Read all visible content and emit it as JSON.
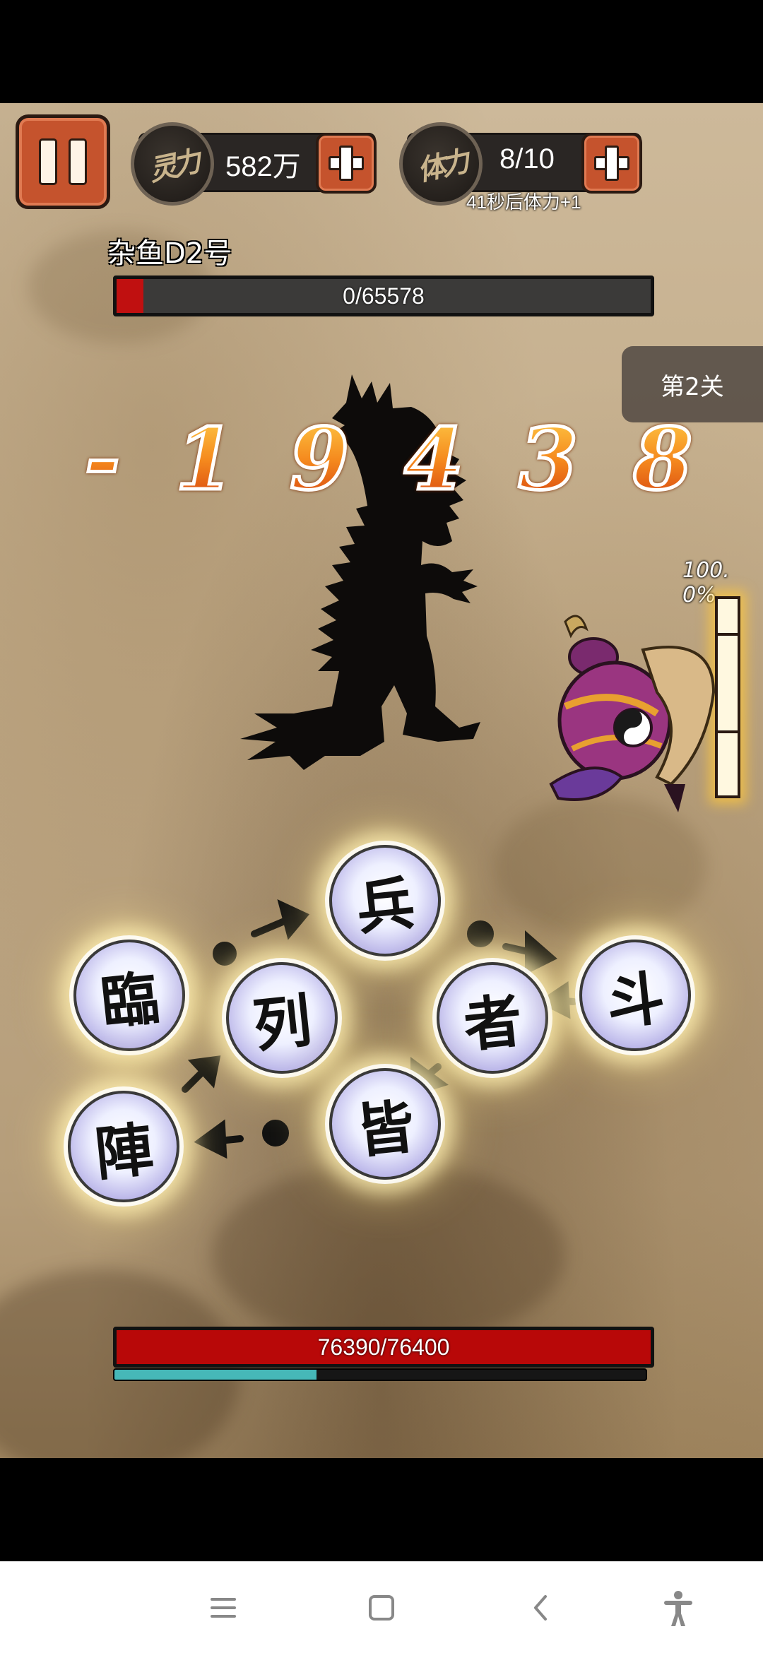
{
  "hud": {
    "spirit_power": {
      "icon_text": "灵力",
      "value": "582万"
    },
    "stamina": {
      "icon_text": "体力",
      "value": "8/10",
      "regen_text": "41秒后体力+1"
    }
  },
  "enemy": {
    "name": "杂鱼D2号",
    "hp_text": "0/65578",
    "hp_fraction": 0.05
  },
  "level": {
    "label": "第2关"
  },
  "damage": {
    "chars": [
      "-",
      "1",
      "9",
      "4",
      "3",
      "8"
    ]
  },
  "charge": {
    "percent_text": "100. 0%",
    "fraction": 1.0
  },
  "seals": {
    "lin": "臨",
    "bing": "兵",
    "dou": "斗",
    "zhe": "者",
    "jie": "皆",
    "zhen": "陣",
    "lie": "列"
  },
  "player": {
    "hp_text": "76390/76400",
    "hp_fraction": 0.9999,
    "xp_fraction": 0.38
  },
  "colors": {
    "accent_button": "#c5532d",
    "hp_red": "#b80808",
    "xp_teal": "#46b8b8",
    "parchment": "#c2ab88"
  },
  "nav": {
    "icons": [
      "menu-icon",
      "home-icon",
      "back-icon",
      "accessibility-icon"
    ]
  }
}
